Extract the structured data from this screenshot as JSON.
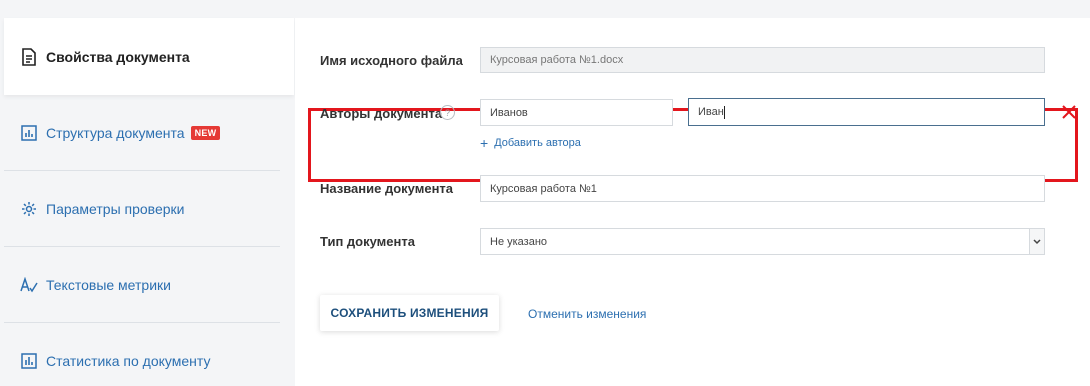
{
  "sidebar": {
    "items": [
      {
        "label": "Свойства документа",
        "icon": "document-icon",
        "active": true
      },
      {
        "label": "Структура документа",
        "icon": "structure-chart-icon",
        "badge": "NEW"
      },
      {
        "label": "Параметры проверки",
        "icon": "gear-icon"
      },
      {
        "label": "Текстовые метрики",
        "icon": "text-metrics-icon"
      },
      {
        "label": "Статистика по документу",
        "icon": "bar-chart-icon"
      }
    ]
  },
  "form": {
    "source_file": {
      "label": "Имя исходного файла",
      "value": "Курсовая работа №1.docx"
    },
    "authors": {
      "label": "Авторы документа",
      "help": "?",
      "last_name": "Иванов",
      "first_name": "Иван",
      "add_label": "Добавить автора"
    },
    "title": {
      "label": "Название документа",
      "value": "Курсовая работа №1"
    },
    "doc_type": {
      "label": "Тип документа",
      "value": "Не указано"
    }
  },
  "actions": {
    "save_label": "СОХРАНИТЬ ИЗМЕНЕНИЯ",
    "cancel_label": "Отменить изменения"
  },
  "colors": {
    "accent": "#2c6fb0",
    "highlight": "#e3161d",
    "badge": "#e53935"
  }
}
